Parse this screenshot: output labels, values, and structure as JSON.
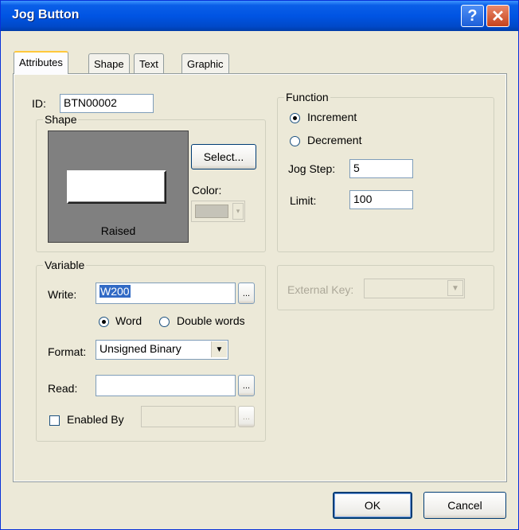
{
  "window": {
    "title": "Jog Button"
  },
  "title_buttons": {
    "help": "?",
    "close": "✕"
  },
  "tabs": [
    {
      "label": "Attributes"
    },
    {
      "label": "Shape"
    },
    {
      "label": "Text"
    },
    {
      "label": "Graphic"
    }
  ],
  "attributes": {
    "id_label": "ID:",
    "id_value": "BTN00002",
    "shape": {
      "legend": "Shape",
      "preview_caption": "Raised",
      "select_button": "Select...",
      "color_label": "Color:"
    },
    "function": {
      "legend": "Function",
      "increment_label": "Increment",
      "increment_selected": true,
      "decrement_label": "Decrement",
      "jog_step_label": "Jog Step:",
      "jog_step_value": "5",
      "limit_label": "Limit:",
      "limit_value": "100"
    },
    "variable": {
      "legend": "Variable",
      "write_label": "Write:",
      "write_value": "W200",
      "browse_label": "...",
      "word_label": "Word",
      "double_words_label": "Double words",
      "format_label": "Format:",
      "format_value": "Unsigned Binary",
      "read_label": "Read:",
      "read_value": "",
      "enabled_by_label": "Enabled By",
      "enabled_by_value": ""
    },
    "external_key_label": "External Key:"
  },
  "footer": {
    "ok_label": "OK",
    "cancel_label": "Cancel"
  },
  "colors": {
    "titlebar": "#0054e3",
    "dialog_bg": "#ece9d8",
    "preview_bg": "#808080",
    "selection": "#316ac5"
  }
}
